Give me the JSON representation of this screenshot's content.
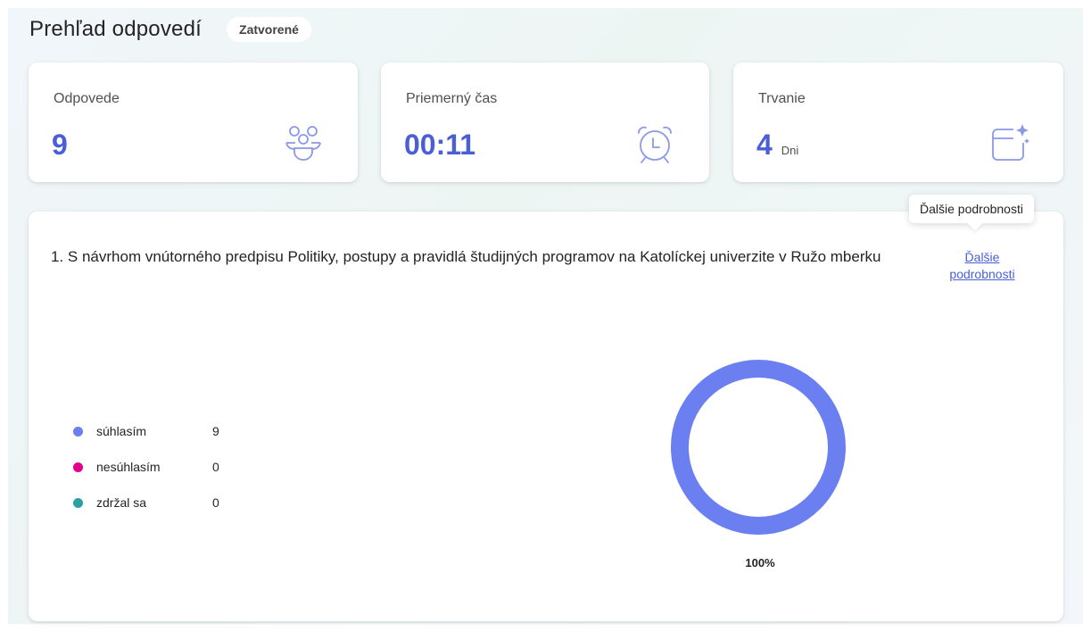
{
  "header": {
    "title": "Prehľad odpovedí",
    "status_badge": "Zatvorené"
  },
  "stats": [
    {
      "label": "Odpovede",
      "value": "9",
      "unit": "",
      "icon": "people-group-icon"
    },
    {
      "label": "Priemerný čas",
      "value": "00:11",
      "unit": "",
      "icon": "alarm-clock-icon"
    },
    {
      "label": "Trvanie",
      "value": "4",
      "unit": "Dni",
      "icon": "calendar-sparkle-icon"
    }
  ],
  "question": {
    "text": "1. S návrhom vnútorného predpisu Politiky, postupy a pravidlá študijných programov na Katolíckej univerzite v Ružo mberku",
    "details_link_line1": "Ďalšie",
    "details_link_line2": "podrobnosti",
    "tooltip": "Ďalšie podrobnosti"
  },
  "colors": {
    "accent": "#4a5fd6",
    "suhlasim": "#6b7ff0",
    "nesuhlasim": "#e3008c",
    "zdrzal": "#2aa0a4"
  },
  "chart_data": {
    "type": "pie",
    "categories": [
      "súhlasím",
      "nesúhlasím",
      "zdržal sa"
    ],
    "values": [
      9,
      0,
      0
    ],
    "percent_labels": [
      "100%"
    ]
  }
}
